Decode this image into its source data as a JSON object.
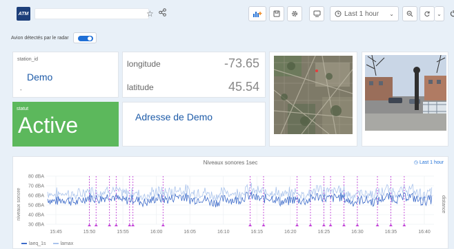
{
  "header": {
    "logo_text": "ATM",
    "buttons": {
      "time_range": "Last 1 hour"
    }
  },
  "variable": {
    "label": "Avion détectés par le radar",
    "toggle_on": true
  },
  "panels": {
    "station": {
      "title": "station_id",
      "value": "Demo",
      "sub": "-"
    },
    "longitude": {
      "label": "longitude",
      "value": "-73.65"
    },
    "latitude": {
      "label": "latitude",
      "value": "45.54"
    },
    "statut": {
      "title": "statut",
      "value": "Active",
      "color": "#5cb85c"
    },
    "address": {
      "value": "Adresse de Demo"
    }
  },
  "chart": {
    "title": "Niveaux sonores 1sec",
    "time_label": "Last 1 hour",
    "ylabel": "niveaux sonore",
    "y2label": "distance",
    "legend": [
      "laeq_1s",
      "lamax"
    ]
  },
  "chart_data": {
    "type": "line",
    "x_ticks": [
      "15:45",
      "15:50",
      "15:55",
      "16:00",
      "16:05",
      "16:10",
      "16:15",
      "16:20",
      "16:25",
      "16:30",
      "16:35",
      "16:40"
    ],
    "y_ticks": [
      "80 dBA",
      "70 dBA",
      "60 dBA",
      "50 dBA",
      "40 dBA",
      "30 dBA"
    ],
    "ylim": [
      30,
      80
    ],
    "series": [
      {
        "name": "laeq_1s",
        "color": "#3d6bc9"
      },
      {
        "name": "lamax",
        "color": "#a9c3ec"
      }
    ],
    "events_color": "#c342d8",
    "event_times": [
      "15:50",
      "15:51",
      "15:53",
      "15:54",
      "15:56",
      "15:56:30",
      "16:01",
      "16:14",
      "16:16",
      "16:21",
      "16:23",
      "16:25",
      "16:26",
      "16:28",
      "16:30",
      "16:33",
      "16:35",
      "16:37"
    ]
  }
}
